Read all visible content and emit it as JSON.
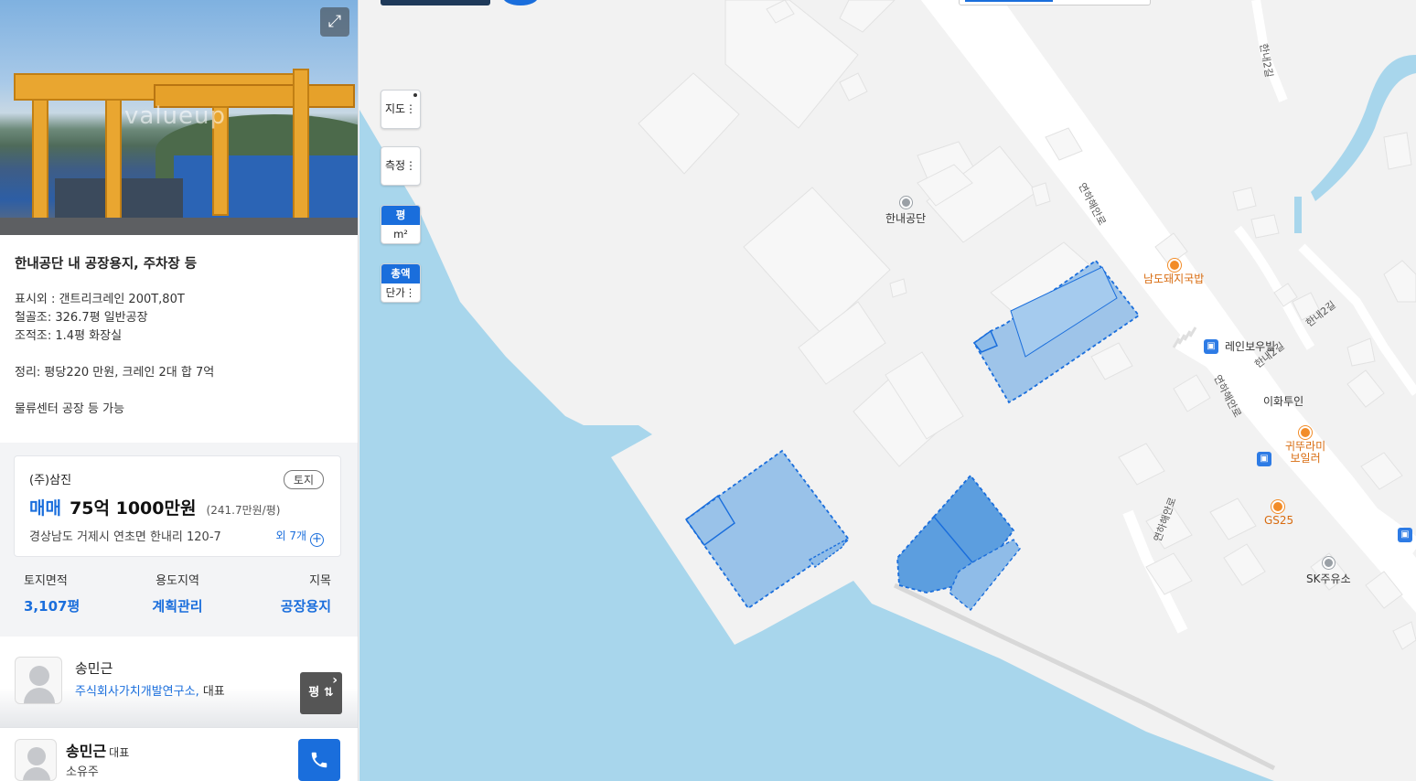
{
  "listing": {
    "title": "한내공단 내 공장용지, 주차장 등",
    "description": [
      "표시외 : 갠트리크레인 200T,80T",
      "철골조: 326.7평 일반공장",
      "조적조: 1.4평 화장실",
      "",
      "정리: 평당220 만원, 크레인 2대 합 7억",
      "",
      "물류센터 공장 등 가능"
    ],
    "photo_watermark": "valueup"
  },
  "price_card": {
    "company": "(주)삼진",
    "tag": "토지",
    "deal_type": "매매",
    "price": "75억 1000만원",
    "unit_price": "(241.7만원/평)",
    "address": "경상남도 거제시 연초면 한내리 120-7",
    "more_label": "외 7개"
  },
  "stats": [
    {
      "label": "토지면적",
      "value": "3,107평"
    },
    {
      "label": "용도지역",
      "value": "계획관리"
    },
    {
      "label": "지목",
      "value": "공장용지"
    }
  ],
  "agent": {
    "name": "송민근",
    "org": "주식회사가치개발연구소",
    "role": "대표"
  },
  "unit_toggle": {
    "label": "평",
    "icon": "swap-icon"
  },
  "footer": {
    "name": "송민근",
    "rep": "대표",
    "owner_label": "소유주",
    "call_icon": "phone-icon"
  },
  "map_controls": {
    "map_label": "지도",
    "measure_label": "측정",
    "area_units": [
      "평",
      "m²"
    ],
    "price_units": [
      "총액",
      "단가"
    ]
  },
  "map_labels": {
    "hannae_gongdan": "한내공단",
    "namdo_pork": "남도돼지국밥",
    "rain_boutique": "레인보우빌",
    "ihwa_tooin": "이화투인",
    "gwitturami_line1": "귀뚜라미",
    "gwitturami_line2": "보일러",
    "gs25": "GS25",
    "sk_gas": "SK주유소",
    "road_yeonha_1": "연하해안로",
    "road_yeonha_2": "연하해안로",
    "road_yeonha_3": "연하해안로",
    "road_hannae2gil_1": "한내2길",
    "road_hannae2gil_2": "한내2길",
    "road_hannae2gil_3": "한내2길"
  },
  "colors": {
    "accent": "#1a6edc",
    "sea": "#a8d6ec",
    "parcel_fill": "#8fbce8",
    "parcel_stroke": "#1a6edc",
    "poi_orange": "#f28c28"
  }
}
